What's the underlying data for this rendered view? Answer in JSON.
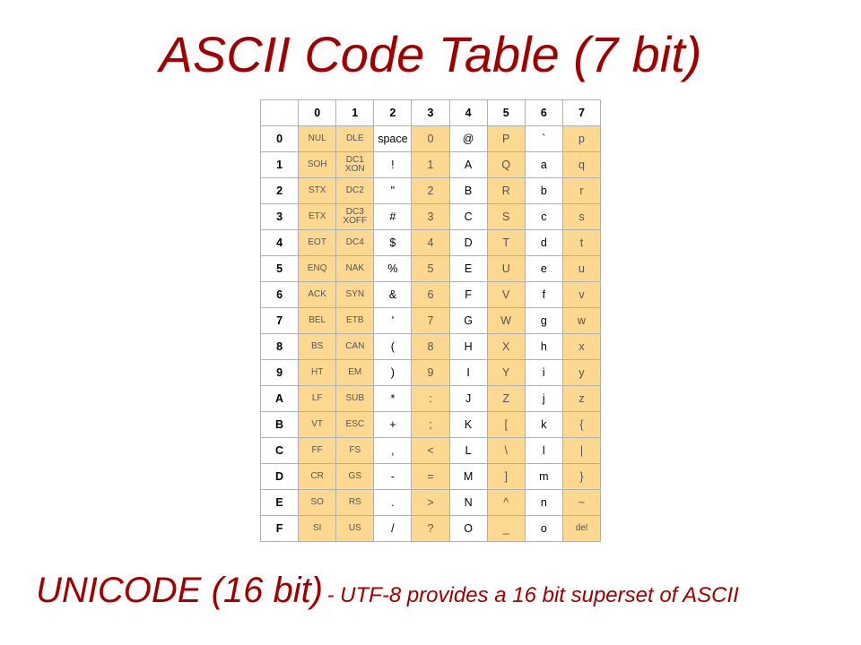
{
  "title": "ASCII Code Table (7 bit)",
  "caption": {
    "big": "UNICODE (16 bit)",
    "small": " -  UTF-8 provides a 16 bit superset of ASCII"
  },
  "columns": [
    "0",
    "1",
    "2",
    "3",
    "4",
    "5",
    "6",
    "7"
  ],
  "rows": [
    "0",
    "1",
    "2",
    "3",
    "4",
    "5",
    "6",
    "7",
    "8",
    "9",
    "A",
    "B",
    "C",
    "D",
    "E",
    "F"
  ],
  "orangeCols": [
    0,
    1,
    3,
    5,
    7
  ],
  "cells": [
    [
      "NUL",
      "DLE",
      "space",
      "0",
      "@",
      "P",
      "`",
      "p"
    ],
    [
      "SOH",
      "DC1\nXON",
      "!",
      "1",
      "A",
      "Q",
      "a",
      "q"
    ],
    [
      "STX",
      "DC2",
      "\"",
      "2",
      "B",
      "R",
      "b",
      "r"
    ],
    [
      "ETX",
      "DC3\nXOFF",
      "#",
      "3",
      "C",
      "S",
      "c",
      "s"
    ],
    [
      "EOT",
      "DC4",
      "$",
      "4",
      "D",
      "T",
      "d",
      "t"
    ],
    [
      "ENQ",
      "NAK",
      "%",
      "5",
      "E",
      "U",
      "e",
      "u"
    ],
    [
      "ACK",
      "SYN",
      "&",
      "6",
      "F",
      "V",
      "f",
      "v"
    ],
    [
      "BEL",
      "ETB",
      "'",
      "7",
      "G",
      "W",
      "g",
      "w"
    ],
    [
      "BS",
      "CAN",
      "(",
      "8",
      "H",
      "X",
      "h",
      "x"
    ],
    [
      "HT",
      "EM",
      ")",
      "9",
      "I",
      "Y",
      "i",
      "y"
    ],
    [
      "LF",
      "SUB",
      "*",
      ":",
      "J",
      "Z",
      "j",
      "z"
    ],
    [
      "VT",
      "ESC",
      "+",
      ";",
      "K",
      "[",
      "k",
      "{"
    ],
    [
      "FF",
      "FS",
      ",",
      "<",
      "L",
      "\\",
      "l",
      "|"
    ],
    [
      "CR",
      "GS",
      "-",
      "=",
      "M",
      "]",
      "m",
      "}"
    ],
    [
      "SO",
      "RS",
      ".",
      ">",
      "N",
      "^",
      "n",
      "~"
    ],
    [
      "SI",
      "US",
      "/",
      "?",
      "O",
      "_",
      "o",
      "del"
    ]
  ]
}
